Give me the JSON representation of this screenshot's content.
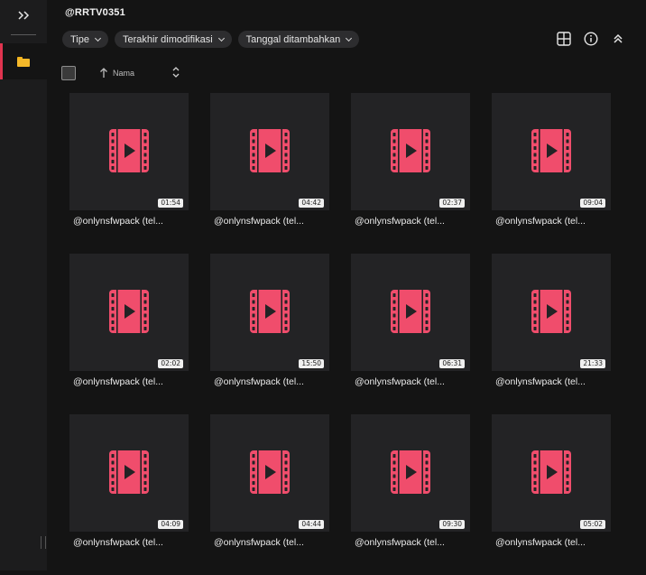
{
  "sidebar": {
    "expand_icon": "double-chevron-right-icon",
    "items": [
      {
        "icon": "folder-icon",
        "active": true
      }
    ]
  },
  "header": {
    "title": "@RRTV0351"
  },
  "filters": [
    {
      "label": "Tipe"
    },
    {
      "label": "Terakhir dimodifikasi"
    },
    {
      "label": "Tanggal ditambahkan"
    }
  ],
  "toolbar": {
    "icons": [
      "grid-view-icon",
      "info-icon",
      "collapse-icon"
    ]
  },
  "sort": {
    "label": "Nama",
    "direction": "ascending"
  },
  "colors": {
    "accent": "#e0344f",
    "video_icon": "#f04d6c",
    "folder": "#f5b92a"
  },
  "files": [
    {
      "name": "@onlynsfwpack (tel...",
      "duration": "01:54"
    },
    {
      "name": "@onlynsfwpack (tel...",
      "duration": "04:42"
    },
    {
      "name": "@onlynsfwpack (tel...",
      "duration": "02:37"
    },
    {
      "name": "@onlynsfwpack (tel...",
      "duration": "09:04"
    },
    {
      "name": "@onlynsfwpack (tel...",
      "duration": "02:02"
    },
    {
      "name": "@onlynsfwpack (tel...",
      "duration": "15:50"
    },
    {
      "name": "@onlynsfwpack (tel...",
      "duration": "06:31"
    },
    {
      "name": "@onlynsfwpack (tel...",
      "duration": "21:33"
    },
    {
      "name": "@onlynsfwpack (tel...",
      "duration": "04:09"
    },
    {
      "name": "@onlynsfwpack (tel...",
      "duration": "04:44"
    },
    {
      "name": "@onlynsfwpack (tel...",
      "duration": "09:30"
    },
    {
      "name": "@onlynsfwpack (tel...",
      "duration": "05:02"
    }
  ]
}
